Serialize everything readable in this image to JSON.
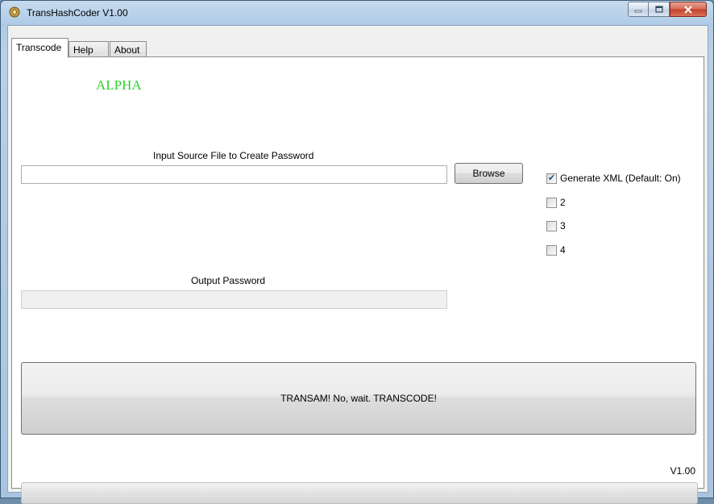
{
  "window": {
    "title": "TransHashCoder V1.00"
  },
  "tabs": [
    {
      "label": "Transcode",
      "active": true
    },
    {
      "label": "Help",
      "active": false
    },
    {
      "label": "About",
      "active": false
    }
  ],
  "transcode": {
    "stage_label": "ALPHA",
    "input_label": "Input Source File to Create Password",
    "input_value": "",
    "browse_label": "Browse",
    "output_label": "Output Password",
    "output_value": "",
    "options": [
      {
        "label": "Generate XML (Default: On)",
        "checked": true
      },
      {
        "label": "2",
        "checked": false
      },
      {
        "label": "3",
        "checked": false
      },
      {
        "label": "4",
        "checked": false
      }
    ],
    "transcode_button_label": "TRANSAM! No, wait. TRANSCODE!",
    "version_label": "V1.00",
    "progress": 0
  },
  "colors": {
    "accent": "#2dd12d"
  }
}
